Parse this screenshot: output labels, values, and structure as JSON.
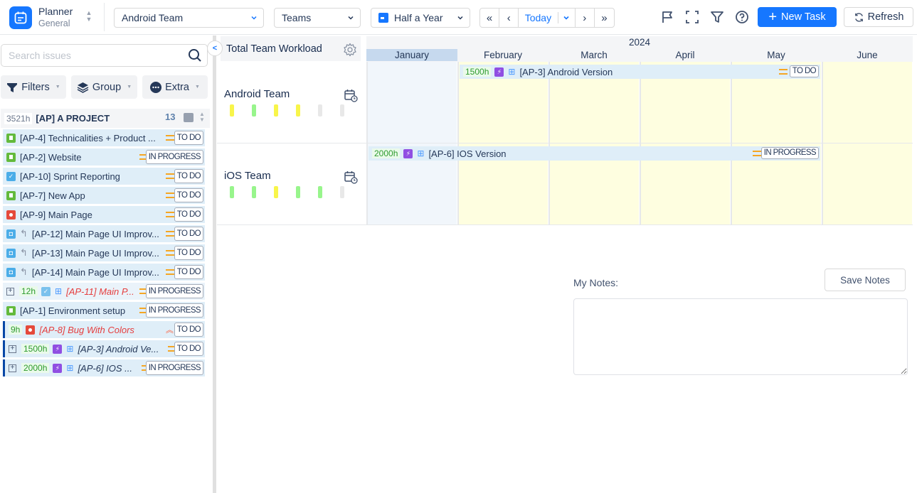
{
  "app": {
    "title": "Planner",
    "subtitle": "General",
    "icon": "calendar-icon"
  },
  "toolbar": {
    "team_select": "Android Team",
    "group_select": "Teams",
    "period_select": "Half a Year",
    "nav": {
      "first": "«",
      "prev": "‹",
      "today": "Today",
      "next": "›",
      "last": "»"
    },
    "icons": [
      "flag-icon",
      "fullscreen-icon",
      "filter-icon",
      "help-icon"
    ],
    "new_task": "New Task",
    "refresh": "Refresh",
    "accent": "#1677ff"
  },
  "sidebar": {
    "search_placeholder": "Search issues",
    "search_value": "",
    "buttons": {
      "filters": "Filters",
      "group": "Group",
      "extra": "Extra"
    },
    "project": {
      "hours": "3521h",
      "name": "[AP] A PROJECT",
      "count": "13"
    },
    "issues": [
      {
        "type": "story",
        "title": "[AP-4] Technicalities + Product ...",
        "priority": "medium",
        "status": "TO DO"
      },
      {
        "type": "story",
        "title": "[AP-2] Website",
        "priority": "medium",
        "status": "IN PROGRESS"
      },
      {
        "type": "task",
        "title": "[AP-10] Sprint Reporting",
        "priority": "medium",
        "status": "TO DO"
      },
      {
        "type": "story",
        "title": "[AP-7] New App",
        "priority": "medium",
        "status": "TO DO"
      },
      {
        "type": "bug",
        "title": "[AP-9] Main Page",
        "priority": "medium",
        "status": "TO DO"
      },
      {
        "type": "subtask",
        "title": "[AP-12] Main Page UI Improv...",
        "priority": "medium",
        "status": "TO DO"
      },
      {
        "type": "subtask",
        "title": "[AP-13] Main Page UI Improv...",
        "priority": "medium",
        "status": "TO DO"
      },
      {
        "type": "subtask",
        "title": "[AP-14] Main Page UI Improv...",
        "priority": "medium",
        "status": "TO DO"
      },
      {
        "type": "task",
        "hours": "12h",
        "title": "[AP-11] Main P...",
        "priority": "medium",
        "status": "IN PROGRESS"
      },
      {
        "type": "story",
        "title": "[AP-1] Environment setup",
        "priority": "medium",
        "status": "IN PROGRESS"
      },
      {
        "type": "bug",
        "hours": "9h",
        "title": "[AP-8] Bug With Colors",
        "priority": "high",
        "status": "TO DO"
      },
      {
        "type": "epic",
        "hours": "1500h",
        "title": "[AP-3] Android Ve...",
        "priority": "medium",
        "status": "TO DO"
      },
      {
        "type": "epic",
        "hours": "2000h",
        "title": "[AP-6] IOS ...",
        "priority": "medium",
        "status": "IN PROGRESS"
      }
    ]
  },
  "workload": {
    "title": "Total Team Workload",
    "year": "2024",
    "months": [
      "January",
      "February",
      "March",
      "April",
      "May",
      "June"
    ],
    "current_month": "January",
    "teams": [
      {
        "name": "Android Team",
        "load_levels": [
          "medium",
          "ok",
          "medium",
          "medium",
          "none",
          "none"
        ],
        "task": {
          "hours": "1500h",
          "title": "[AP-3] Android Version",
          "status": "TO DO",
          "start_month": "February",
          "end_month": "May"
        }
      },
      {
        "name": "iOS Team",
        "load_levels": [
          "ok",
          "ok",
          "medium",
          "ok",
          "ok",
          "none"
        ],
        "task": {
          "hours": "2000h",
          "title": "[AP-6] IOS Version",
          "status": "IN PROGRESS",
          "start_month": "January",
          "end_month": "May"
        }
      }
    ],
    "load_colors": {
      "ok": "#98f58c",
      "medium": "#f8f54a",
      "none": "#e8e8e8"
    }
  },
  "notes": {
    "label": "My Notes:",
    "save": "Save Notes",
    "value": ""
  }
}
